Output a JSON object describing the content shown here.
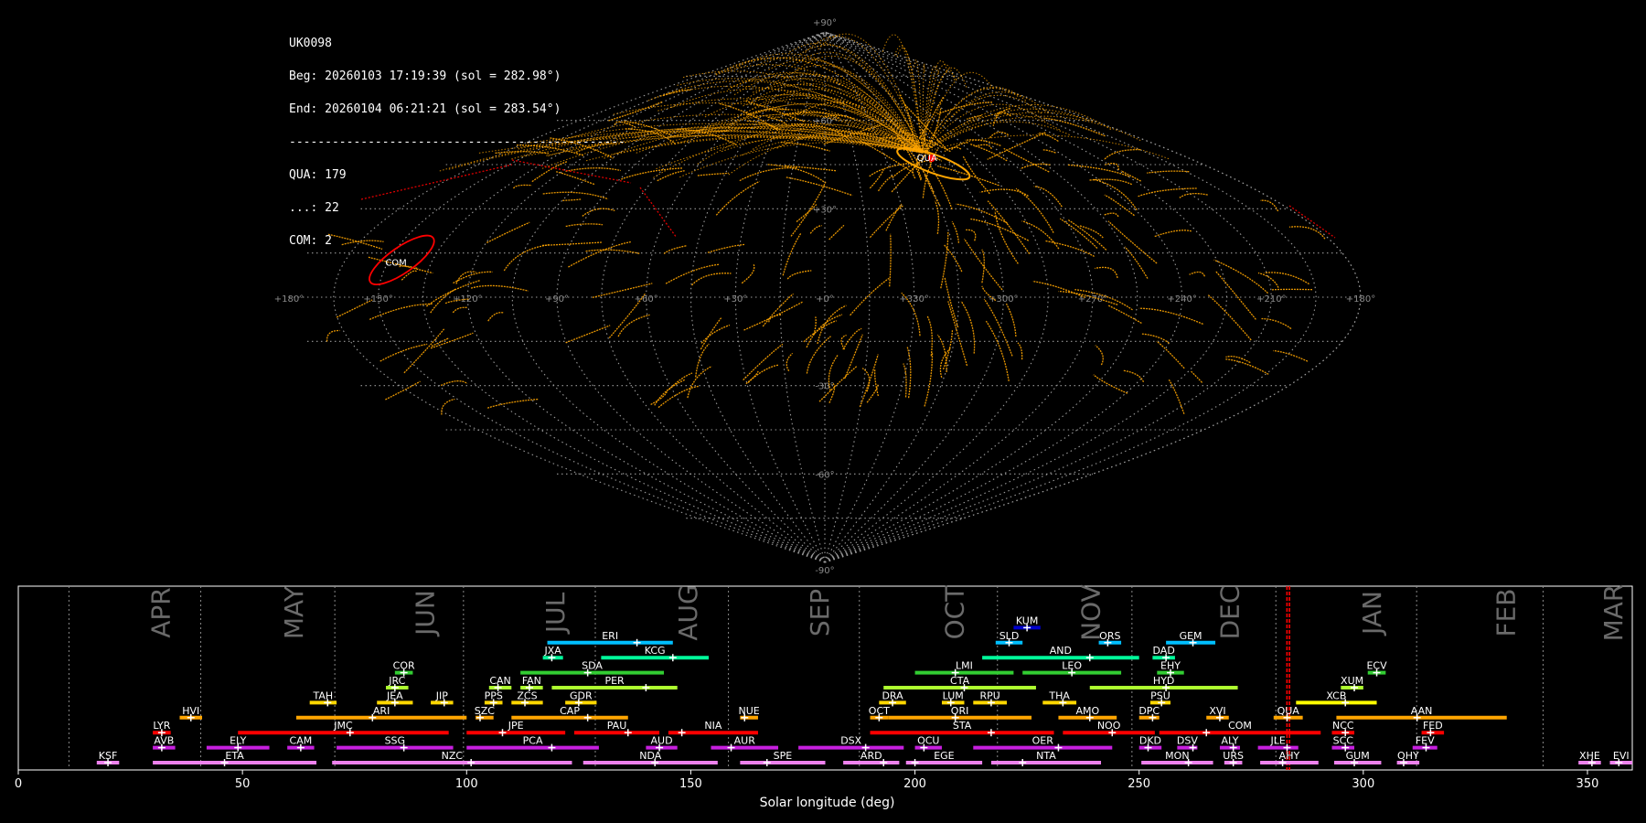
{
  "info": {
    "station": "UK0098",
    "begin": "Beg: 20260103 17:19:39 (sol = 282.98°)",
    "end": "End: 20260104 06:21:21 (sol = 283.54°)",
    "separator": "-----------------------------------------------",
    "counts": [
      "QUA: 179",
      "...: 22",
      "COM: 2"
    ]
  },
  "chart_data": [
    {
      "type": "scatter",
      "name": "sky-map",
      "projection": "sinusoidal",
      "grid": true,
      "lon_labels": [
        "+180°",
        "+150°",
        "+120°",
        "+90°",
        "+60°",
        "+30°",
        "+0°",
        "+330°",
        "+300°",
        "+270°",
        "+240°",
        "+210°",
        "+180°"
      ],
      "lat_labels": [
        "+90°",
        "+60°",
        "+30°",
        "-30°",
        "-60°",
        "-90°"
      ],
      "radiants": [
        {
          "code": "QUA",
          "lon": 310,
          "lat": 49,
          "color": "#ff0000"
        },
        {
          "code": "COM",
          "lon": 150,
          "lat": 12,
          "color": "#ff0000"
        }
      ],
      "sporadic_color": "#ffa500"
    },
    {
      "type": "bar",
      "name": "shower-activity",
      "xlabel": "Solar longitude (deg)",
      "xlim": [
        0,
        360
      ],
      "xticks": [
        0,
        50,
        100,
        150,
        200,
        250,
        300,
        350
      ],
      "current_sol": [
        282.98,
        283.54
      ],
      "months": [
        {
          "label": "APR",
          "sol": 11.3
        },
        {
          "label": "MAY",
          "sol": 40.7
        },
        {
          "label": "JUN",
          "sol": 70.6
        },
        {
          "label": "JUL",
          "sol": 99.3
        },
        {
          "label": "AUG",
          "sol": 128.7
        },
        {
          "label": "SEP",
          "sol": 158.4
        },
        {
          "label": "OCT",
          "sol": 187.6
        },
        {
          "label": "NOV",
          "sol": 218.4
        },
        {
          "label": "DEC",
          "sol": 248.4
        },
        {
          "label": "JAN",
          "sol": 280.5
        },
        {
          "label": "FEB",
          "sol": 311.9
        },
        {
          "label": "MAR",
          "sol": 340.1
        }
      ],
      "showers": [
        {
          "code": "KSF",
          "start": 17.5,
          "end": 22.5,
          "peak": 20,
          "row": 0,
          "color": "#ee82ee"
        },
        {
          "code": "ETA",
          "start": 30,
          "end": 66.5,
          "peak": 46,
          "row": 0,
          "color": "#ee82ee"
        },
        {
          "code": "NZC",
          "start": 70,
          "end": 123.5,
          "peak": 101,
          "row": 0,
          "color": "#ee82ee"
        },
        {
          "code": "NDA",
          "start": 126,
          "end": 156,
          "peak": 142,
          "row": 0,
          "color": "#ee82ee"
        },
        {
          "code": "SPE",
          "start": 161,
          "end": 180,
          "peak": 167,
          "row": 0,
          "color": "#ee82ee"
        },
        {
          "code": "ARD",
          "start": 184,
          "end": 196.5,
          "peak": 193,
          "row": 0,
          "color": "#ee82ee"
        },
        {
          "code": "EGE",
          "start": 198,
          "end": 215,
          "peak": 200,
          "row": 0,
          "color": "#ee82ee"
        },
        {
          "code": "NTA",
          "start": 217,
          "end": 241.5,
          "peak": 224,
          "row": 0,
          "color": "#ee82ee"
        },
        {
          "code": "MON",
          "start": 250.5,
          "end": 266.5,
          "peak": 261,
          "row": 0,
          "color": "#ee82ee"
        },
        {
          "code": "URS",
          "start": 269,
          "end": 273,
          "peak": 271,
          "row": 0,
          "color": "#ee82ee"
        },
        {
          "code": "AHY",
          "start": 277,
          "end": 290,
          "peak": 282,
          "row": 0,
          "color": "#ee82ee"
        },
        {
          "code": "GUM",
          "start": 293.5,
          "end": 304,
          "peak": 298,
          "row": 0,
          "color": "#ee82ee"
        },
        {
          "code": "OHY",
          "start": 307.5,
          "end": 312.5,
          "peak": 309,
          "row": 0,
          "color": "#ee82ee"
        },
        {
          "code": "XHE",
          "start": 348,
          "end": 353,
          "peak": 351,
          "row": 0,
          "color": "#ee82ee"
        },
        {
          "code": "EVI",
          "start": 355,
          "end": 360,
          "peak": 357,
          "row": 0,
          "color": "#ee82ee"
        },
        {
          "code": "AVB",
          "start": 30,
          "end": 35,
          "peak": 32,
          "row": 1,
          "color": "#c71fdf"
        },
        {
          "code": "ELY",
          "start": 42,
          "end": 56,
          "peak": 49,
          "row": 1,
          "color": "#c71fdf"
        },
        {
          "code": "CAM",
          "start": 60,
          "end": 66,
          "peak": 63,
          "row": 1,
          "color": "#c71fdf"
        },
        {
          "code": "SSG",
          "start": 71,
          "end": 97,
          "peak": 86,
          "row": 1,
          "color": "#c71fdf"
        },
        {
          "code": "PCA",
          "start": 100,
          "end": 129.5,
          "peak": 119,
          "row": 1,
          "color": "#c71fdf"
        },
        {
          "code": "AUD",
          "start": 140,
          "end": 147,
          "peak": 143,
          "row": 1,
          "color": "#c71fdf"
        },
        {
          "code": "AUR",
          "start": 154.5,
          "end": 169.5,
          "peak": 159,
          "row": 1,
          "color": "#c71fdf"
        },
        {
          "code": "DSX",
          "start": 174,
          "end": 197.5,
          "peak": 189,
          "row": 1,
          "color": "#c71fdf"
        },
        {
          "code": "OCU",
          "start": 200,
          "end": 206,
          "peak": 202,
          "row": 1,
          "color": "#c71fdf"
        },
        {
          "code": "OER",
          "start": 213,
          "end": 244,
          "peak": 232,
          "row": 1,
          "color": "#c71fdf"
        },
        {
          "code": "DKD",
          "start": 250,
          "end": 255,
          "peak": 252,
          "row": 1,
          "color": "#c71fdf"
        },
        {
          "code": "DSV",
          "start": 258.5,
          "end": 263,
          "peak": 262,
          "row": 1,
          "color": "#c71fdf"
        },
        {
          "code": "ALY",
          "start": 268,
          "end": 272.5,
          "peak": 271,
          "row": 1,
          "color": "#c71fdf"
        },
        {
          "code": "JLE",
          "start": 276.5,
          "end": 285.5,
          "peak": 283,
          "row": 1,
          "color": "#c71fdf"
        },
        {
          "code": "SCC",
          "start": 293,
          "end": 298,
          "peak": 296,
          "row": 1,
          "color": "#c71fdf"
        },
        {
          "code": "FEV",
          "start": 311,
          "end": 316.5,
          "peak": 314,
          "row": 1,
          "color": "#c71fdf"
        },
        {
          "code": "LYR",
          "start": 30,
          "end": 34,
          "peak": 32,
          "row": 2,
          "color": "#ff0000"
        },
        {
          "code": "JMC",
          "start": 49,
          "end": 96,
          "peak": 74,
          "row": 2,
          "color": "#ff0000"
        },
        {
          "code": "JPE",
          "start": 100,
          "end": 122,
          "peak": 108,
          "row": 2,
          "color": "#ff0000"
        },
        {
          "code": "PAU",
          "start": 124,
          "end": 143,
          "peak": 136,
          "row": 2,
          "color": "#ff0000"
        },
        {
          "code": "NIA",
          "start": 145,
          "end": 165,
          "peak": 148,
          "row": 2,
          "color": "#ff0000"
        },
        {
          "code": "STA",
          "start": 190,
          "end": 231,
          "peak": 217,
          "row": 2,
          "color": "#ff0000"
        },
        {
          "code": "NOO",
          "start": 233,
          "end": 253.5,
          "peak": 244,
          "row": 2,
          "color": "#ff0000"
        },
        {
          "code": "COM",
          "start": 254.5,
          "end": 290.5,
          "peak": 265,
          "row": 2,
          "color": "#ff0000"
        },
        {
          "code": "NCC",
          "start": 293,
          "end": 298,
          "peak": 296,
          "row": 2,
          "color": "#ff0000"
        },
        {
          "code": "FED",
          "start": 313,
          "end": 318,
          "peak": 315,
          "row": 2,
          "color": "#ff0000"
        },
        {
          "code": "HVI",
          "start": 36,
          "end": 41,
          "peak": 38.5,
          "row": 3,
          "color": "#ffa500"
        },
        {
          "code": "ARI",
          "start": 62,
          "end": 100,
          "peak": 79,
          "row": 3,
          "color": "#ffa500"
        },
        {
          "code": "SZC",
          "start": 102,
          "end": 106,
          "peak": 103,
          "row": 3,
          "color": "#ffa500"
        },
        {
          "code": "CAP",
          "start": 110,
          "end": 136,
          "peak": 127,
          "row": 3,
          "color": "#ffa500"
        },
        {
          "code": "NUE",
          "start": 161,
          "end": 165,
          "peak": 162,
          "row": 3,
          "color": "#ffa500"
        },
        {
          "code": "OCT",
          "start": 190,
          "end": 194,
          "peak": 192,
          "row": 3,
          "color": "#ffa500"
        },
        {
          "code": "ORI",
          "start": 194,
          "end": 226,
          "peak": 209,
          "row": 3,
          "color": "#ffa500"
        },
        {
          "code": "AMO",
          "start": 232,
          "end": 245,
          "peak": 239,
          "row": 3,
          "color": "#ffa500"
        },
        {
          "code": "DPC",
          "start": 250,
          "end": 254.5,
          "peak": 253,
          "row": 3,
          "color": "#ffa500"
        },
        {
          "code": "XVI",
          "start": 265,
          "end": 270,
          "peak": 268,
          "row": 3,
          "color": "#ffa500"
        },
        {
          "code": "QUA",
          "start": 280,
          "end": 286.5,
          "peak": 283,
          "row": 3,
          "color": "#ffa500"
        },
        {
          "code": "AAN",
          "start": 294,
          "end": 332,
          "peak": 312,
          "row": 3,
          "color": "#ffa500"
        },
        {
          "code": "TAH",
          "start": 65,
          "end": 71,
          "peak": 69,
          "row": 4,
          "color": "#ffd700"
        },
        {
          "code": "JEA",
          "start": 80,
          "end": 88,
          "peak": 84,
          "row": 4,
          "color": "#ffd700"
        },
        {
          "code": "JIP",
          "start": 92,
          "end": 97,
          "peak": 95,
          "row": 4,
          "color": "#ffd700"
        },
        {
          "code": "PPS",
          "start": 104,
          "end": 108,
          "peak": 106,
          "row": 4,
          "color": "#ffd700"
        },
        {
          "code": "ZCS",
          "start": 110,
          "end": 117,
          "peak": 113,
          "row": 4,
          "color": "#ffd700"
        },
        {
          "code": "GDR",
          "start": 122,
          "end": 129,
          "peak": 125,
          "row": 4,
          "color": "#ffd700"
        },
        {
          "code": "DRA",
          "start": 192,
          "end": 198,
          "peak": 195,
          "row": 4,
          "color": "#ffd700"
        },
        {
          "code": "LUM",
          "start": 206,
          "end": 211,
          "peak": 208,
          "row": 4,
          "color": "#ffd700"
        },
        {
          "code": "RPU",
          "start": 213,
          "end": 220.5,
          "peak": 217,
          "row": 4,
          "color": "#ffd700"
        },
        {
          "code": "THA",
          "start": 228.5,
          "end": 236,
          "peak": 233,
          "row": 4,
          "color": "#ffd700"
        },
        {
          "code": "PSU",
          "start": 252.5,
          "end": 257,
          "peak": 255,
          "row": 4,
          "color": "#ffd700"
        },
        {
          "code": "XCB",
          "start": 285,
          "end": 303,
          "peak": 296,
          "row": 4,
          "color": "#ffff00"
        },
        {
          "code": "JRC",
          "start": 82,
          "end": 87,
          "peak": 84,
          "row": 5,
          "color": "#adff2f"
        },
        {
          "code": "CAN",
          "start": 105,
          "end": 110,
          "peak": 107,
          "row": 5,
          "color": "#adff2f"
        },
        {
          "code": "FAN",
          "start": 112,
          "end": 117,
          "peak": 114,
          "row": 5,
          "color": "#adff2f"
        },
        {
          "code": "PER",
          "start": 119,
          "end": 147,
          "peak": 140,
          "row": 5,
          "color": "#adff2f"
        },
        {
          "code": "CTA",
          "start": 193,
          "end": 227,
          "peak": 211,
          "row": 5,
          "color": "#adff2f"
        },
        {
          "code": "HYD",
          "start": 239,
          "end": 272,
          "peak": 256,
          "row": 5,
          "color": "#adff2f"
        },
        {
          "code": "XUM",
          "start": 295,
          "end": 300,
          "peak": 298,
          "row": 5,
          "color": "#adff2f"
        },
        {
          "code": "COR",
          "start": 84,
          "end": 88,
          "peak": 86,
          "row": 6,
          "color": "#32cd32"
        },
        {
          "code": "SDA",
          "start": 112,
          "end": 144,
          "peak": 127,
          "row": 6,
          "color": "#32cd32"
        },
        {
          "code": "LMI",
          "start": 200,
          "end": 222,
          "peak": 209,
          "row": 6,
          "color": "#32cd32"
        },
        {
          "code": "LEO",
          "start": 224,
          "end": 246,
          "peak": 235,
          "row": 6,
          "color": "#32cd32"
        },
        {
          "code": "EHY",
          "start": 254,
          "end": 260,
          "peak": 257,
          "row": 6,
          "color": "#32cd32"
        },
        {
          "code": "ECV",
          "start": 301,
          "end": 305,
          "peak": 303,
          "row": 6,
          "color": "#32cd32"
        },
        {
          "code": "JXA",
          "start": 117,
          "end": 121.5,
          "peak": 119,
          "row": 7,
          "color": "#00fa9a"
        },
        {
          "code": "KCG",
          "start": 130,
          "end": 154,
          "peak": 146,
          "row": 7,
          "color": "#00fa9a"
        },
        {
          "code": "AND",
          "start": 215,
          "end": 250,
          "peak": 239,
          "row": 7,
          "color": "#00fa9a"
        },
        {
          "code": "DAD",
          "start": 253,
          "end": 258,
          "peak": 256,
          "row": 7,
          "color": "#00fa9a"
        },
        {
          "code": "ERI",
          "start": 118,
          "end": 146,
          "peak": 138,
          "row": 8,
          "color": "#00bfff"
        },
        {
          "code": "SLD",
          "start": 218,
          "end": 224,
          "peak": 221,
          "row": 8,
          "color": "#00bfff"
        },
        {
          "code": "ORS",
          "start": 241,
          "end": 246,
          "peak": 243,
          "row": 8,
          "color": "#00bfff"
        },
        {
          "code": "GEM",
          "start": 256,
          "end": 267,
          "peak": 262,
          "row": 8,
          "color": "#00bfff"
        },
        {
          "code": "KUM",
          "start": 222,
          "end": 228,
          "peak": 225,
          "row": 9,
          "color": "#0000cd"
        }
      ]
    }
  ]
}
